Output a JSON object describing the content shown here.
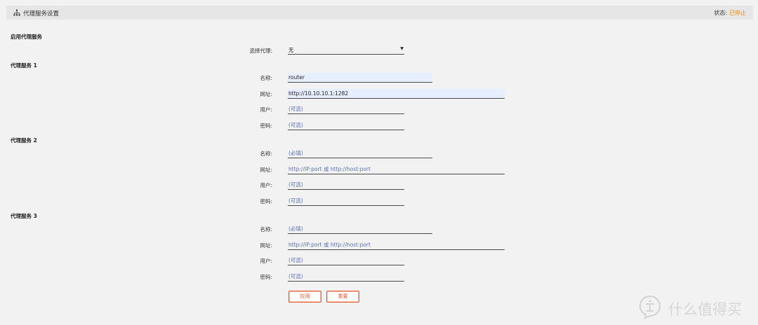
{
  "header": {
    "title": "代理服务设置",
    "status_label": "状态:",
    "status_value": "已停止"
  },
  "enable": {
    "section_title": "启用代理服务",
    "select_label": "选择代理:",
    "select_value": "无"
  },
  "proxy1": {
    "title": "代理服务 1",
    "name_label": "名称:",
    "name_value": "router",
    "url_label": "网址:",
    "url_value": "http://10.10.10.1:1282",
    "user_label": "用户:",
    "user_placeholder": "(可选)",
    "pass_label": "密码:",
    "pass_placeholder": "(可选)"
  },
  "proxy2": {
    "title": "代理服务 2",
    "name_label": "名称:",
    "name_placeholder": "(必填)",
    "url_label": "网址:",
    "url_placeholder": "http://IP:port 或 http://host:port",
    "user_label": "用户:",
    "user_placeholder": "(可选)",
    "pass_label": "密码:",
    "pass_placeholder": "(可选)"
  },
  "proxy3": {
    "title": "代理服务 3",
    "name_label": "名称:",
    "name_placeholder": "(必填)",
    "url_label": "网址:",
    "url_placeholder": "http://IP:port 或 http://host:port",
    "user_label": "用户:",
    "user_placeholder": "(可选)",
    "pass_label": "密码:",
    "pass_placeholder": "(可选)"
  },
  "buttons": {
    "apply": "应用",
    "reset": "重置"
  },
  "watermark": {
    "text": "什么值得买",
    "icon": "smzdm-logo-icon"
  },
  "colors": {
    "accent": "#e8562a",
    "status": "#ee8a1a",
    "placeholder": "#5a73b3",
    "filled_bg": "#e6efff"
  }
}
